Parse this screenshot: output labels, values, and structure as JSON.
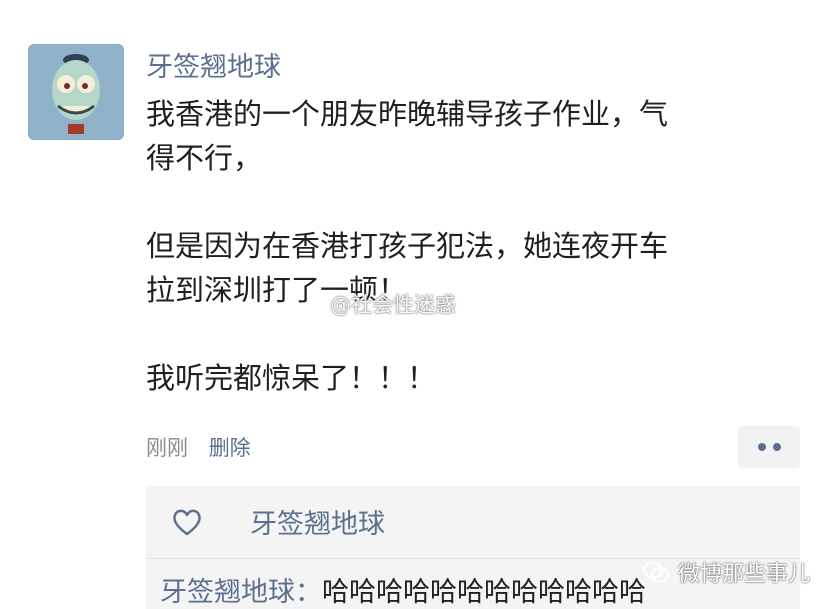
{
  "post": {
    "username": "牙签翘地球",
    "lines": [
      "我香港的一个朋友昨晚辅导孩子作业，气",
      "得不行，",
      "但是因为在香港打孩子犯法，她连夜开车",
      "拉到深圳打了一顿！",
      "我听完都惊呆了！！！"
    ],
    "time": "刚刚",
    "delete_label": "删除",
    "more_icon": "more-dots-icon"
  },
  "likes": {
    "icon": "heart-icon",
    "users": "牙签翘地球"
  },
  "comment": {
    "author": "牙签翘地球：",
    "text": "哈哈哈哈哈哈哈哈哈哈哈哈"
  },
  "watermarks": {
    "middle": "@社会性迷惑",
    "brand": "微博那些事儿"
  },
  "colors": {
    "name_blue": "#5c6f8e",
    "text": "#202020",
    "muted": "#8c8c8c",
    "panel": "#f4f4f4"
  }
}
